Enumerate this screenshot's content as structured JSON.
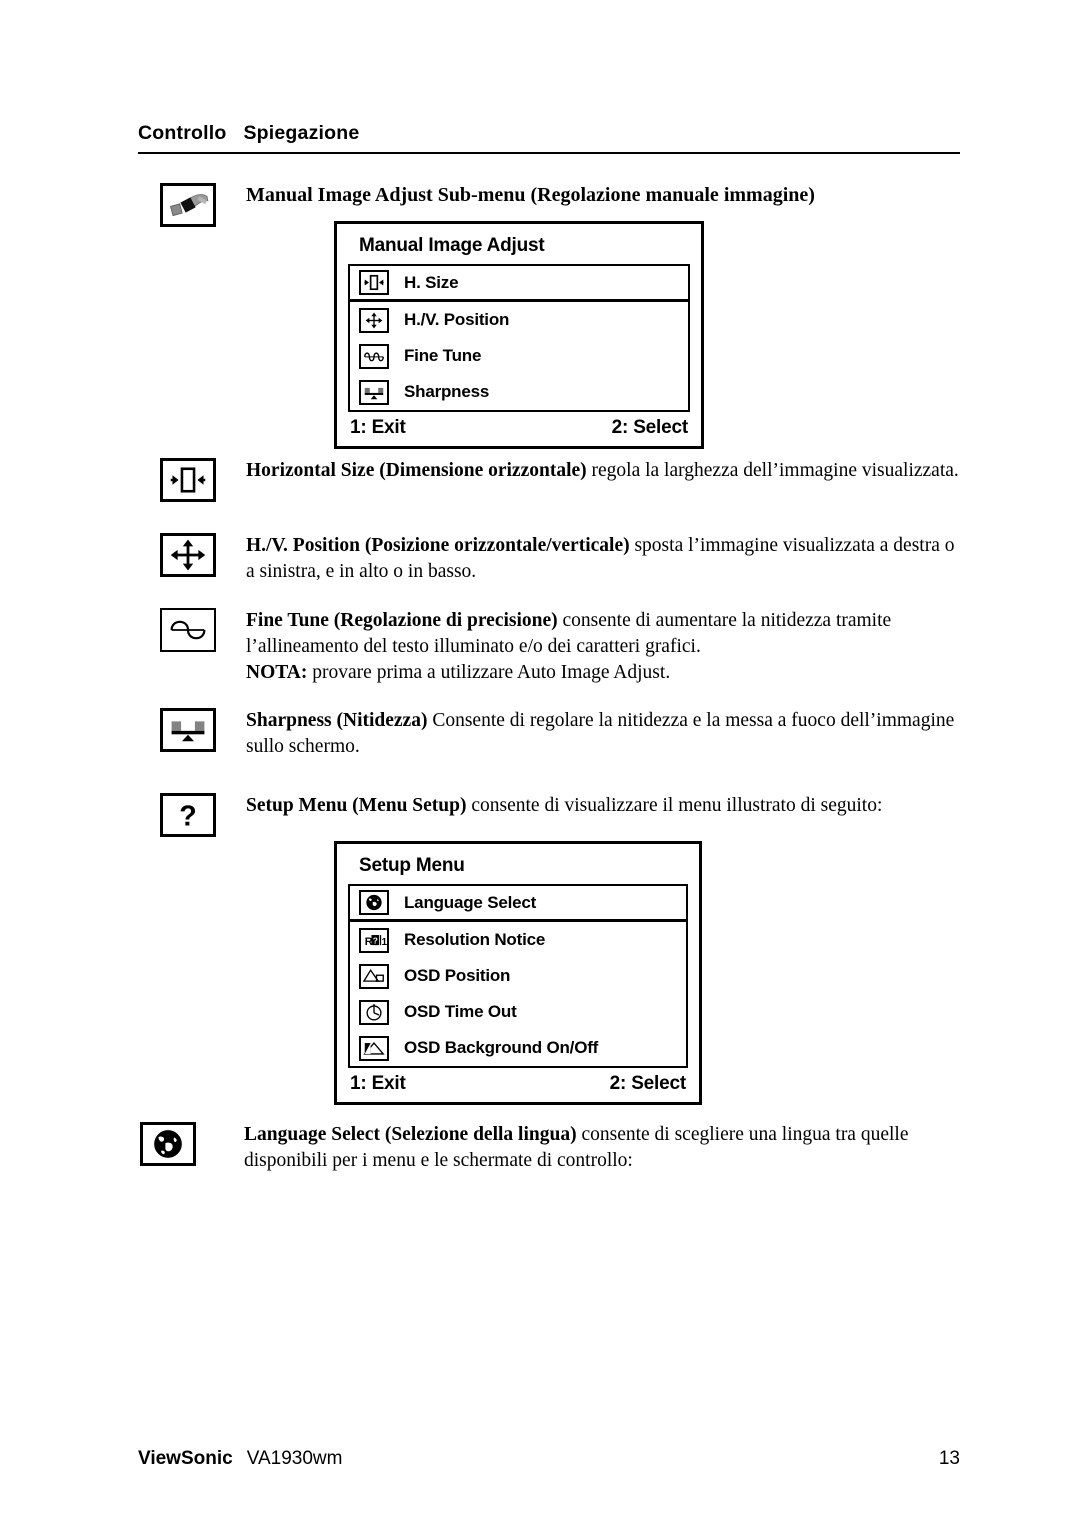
{
  "header": {
    "col_control": "Controllo",
    "col_explanation": "Spiegazione"
  },
  "sections": {
    "manual_image_adjust": {
      "icon": "manual-adjust-hand-icon",
      "title": "Manual Image Adjust Sub-menu (Regolazione manuale immagine)",
      "osd": {
        "title": "Manual Image Adjust",
        "items": [
          {
            "icon": "h-size-icon",
            "label": "H. Size",
            "selected": true
          },
          {
            "icon": "hv-position-icon",
            "label": "H./V. Position",
            "selected": false
          },
          {
            "icon": "fine-tune-icon",
            "label": "Fine Tune",
            "selected": false
          },
          {
            "icon": "sharpness-icon",
            "label": "Sharpness",
            "selected": false
          }
        ],
        "footer_left": "1: Exit",
        "footer_right": "2: Select"
      }
    },
    "horizontal_size": {
      "icon": "h-size-icon",
      "bold": "Horizontal Size (Dimensione orizzontale)",
      "rest": " regola la larghezza dell’immagine visualizzata."
    },
    "hv_position": {
      "icon": "hv-position-icon",
      "bold": "H./V. Position (Posizione orizzontale/verticale)",
      "rest": " sposta l’immagine visualizzata a destra o a sinistra, e in alto o in basso."
    },
    "fine_tune": {
      "icon": "fine-tune-icon",
      "bold": "Fine Tune (Regolazione di precisione)",
      "rest": " consente di aumentare la nitidezza tramite l’allineamento del testo illuminato e/o dei caratteri grafici.",
      "note_bold": "NOTA:",
      "note_rest": " provare prima a utilizzare Auto Image Adjust."
    },
    "sharpness": {
      "icon": "sharpness-icon",
      "bold": "Sharpness (Nitidezza)",
      "rest": " Consente di regolare la nitidezza e la messa a fuoco dell’immagine sullo schermo."
    },
    "setup_menu": {
      "icon": "question-mark-icon",
      "bold": "Setup Menu (Menu Setup)",
      "rest": " consente di visualizzare il menu illustrato di seguito:",
      "osd": {
        "title": "Setup Menu",
        "items": [
          {
            "icon": "globe-icon",
            "label": "Language Select",
            "selected": true
          },
          {
            "icon": "resolution-notice-icon",
            "label": "Resolution Notice",
            "selected": false
          },
          {
            "icon": "osd-position-icon",
            "label": "OSD Position",
            "selected": false
          },
          {
            "icon": "osd-timeout-icon",
            "label": "OSD Time Out",
            "selected": false
          },
          {
            "icon": "osd-background-icon",
            "label": "OSD Background On/Off",
            "selected": false
          }
        ],
        "footer_left": "1: Exit",
        "footer_right": "2: Select"
      }
    },
    "language_select": {
      "icon": "globe-icon",
      "bold": "Language Select (Selezione della lingua)",
      "rest": " consente di scegliere una lingua tra quelle disponibili per i menu e le schermate di controllo:"
    }
  },
  "footer": {
    "brand": "ViewSonic",
    "model": "VA1930wm",
    "page_number": "13"
  },
  "colors": {
    "ink": "#000000",
    "paper": "#ffffff",
    "icon_gray": "#9a9a9a"
  }
}
